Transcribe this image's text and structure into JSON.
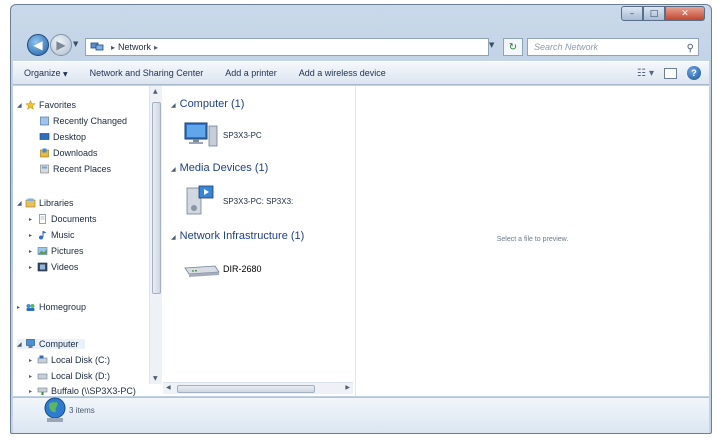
{
  "window": {
    "minimize_glyph": "–",
    "maximize_glyph": "□",
    "close_glyph": "✕"
  },
  "navbar": {
    "back_glyph": "◀",
    "forward_glyph": "▶",
    "breadcrumb": "Network",
    "breadcrumb_separator": "▸",
    "refresh_glyph": "↻",
    "search_placeholder": "Search Network",
    "search_glyph": "⚲"
  },
  "toolbar": {
    "organize_label": "Organize",
    "network_sharing_label": "Network and Sharing Center",
    "add_printer_label": "Add a printer",
    "add_wireless_label": "Add a wireless device",
    "dropdown_glyph": "▼"
  },
  "nav_pane": {
    "favorites": {
      "label": "Favorites",
      "items": [
        "Recently Changed",
        "Desktop",
        "Downloads",
        "Recent Places"
      ]
    },
    "libraries": {
      "label": "Libraries",
      "items": [
        "Documents",
        "Music",
        "Pictures",
        "Videos"
      ]
    },
    "homegroup": {
      "label": "Homegroup"
    },
    "computer": {
      "label": "Computer",
      "items": [
        "Local Disk (C:)",
        "Local Disk (D:)",
        "Buffalo (\\\\SP3X3-PC)"
      ]
    },
    "expand_glyph": "▸",
    "collapse_glyph": "◢"
  },
  "groups": [
    {
      "header": "Computer (1)",
      "items": [
        {
          "label": "SP3X3-PC",
          "icon": "computer-icon"
        }
      ]
    },
    {
      "header": "Media Devices (1)",
      "items": [
        {
          "label": "SP3X3-PC: SP3X3:",
          "icon": "media-device-icon"
        }
      ]
    },
    {
      "header": "Network Infrastructure (1)",
      "items": [
        {
          "label": "DIR-2680",
          "icon": "router-icon"
        }
      ]
    }
  ],
  "preview": {
    "text": "Select a file to preview."
  },
  "details": {
    "count": "3 items"
  },
  "colors": {
    "frame": "#b6c9df",
    "group_header": "#1e3f8a",
    "close_button": "#c1462f"
  }
}
